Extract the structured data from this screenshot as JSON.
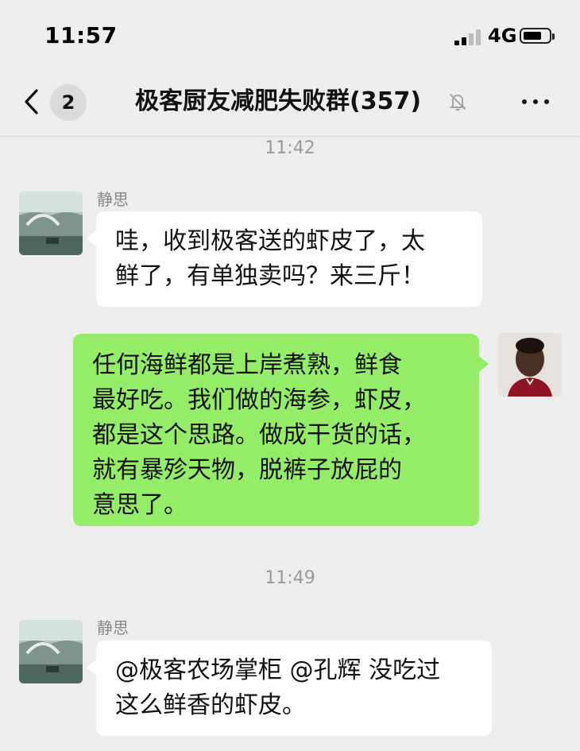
{
  "status_bar": {
    "time": "11:57",
    "network": "4G",
    "icons": [
      "signal-icon",
      "battery-icon"
    ]
  },
  "nav": {
    "unread_count": "2",
    "title": "极客厨友减肥失败群(357)",
    "icons": [
      "back-icon",
      "mute-icon",
      "more-icon"
    ]
  },
  "messages": [
    {
      "kind": "timestamp",
      "text": "11:42"
    },
    {
      "kind": "incoming",
      "sender": "静思",
      "lines": [
        "哇，收到极客送的虾皮了，太",
        "鲜了，有单独卖吗？来三斤！"
      ]
    },
    {
      "kind": "outgoing",
      "lines": [
        "任何海鲜都是上岸煮熟，鲜食",
        "最好吃。我们做的海参，虾皮，",
        "都是这个思路。做成干货的话，",
        "就有暴殄天物，脱裤子放屁的",
        "意思了。"
      ]
    },
    {
      "kind": "timestamp",
      "text": "11:49"
    },
    {
      "kind": "incoming",
      "sender": "静思",
      "lines": [
        "@极客农场掌柜 @孔辉 没吃过",
        "这么鲜香的虾皮。"
      ]
    }
  ],
  "colors": {
    "background": "#EDEDED",
    "incoming_bubble": "#FFFFFF",
    "outgoing_bubble": "#95EC69",
    "muted_text": "#999999"
  }
}
